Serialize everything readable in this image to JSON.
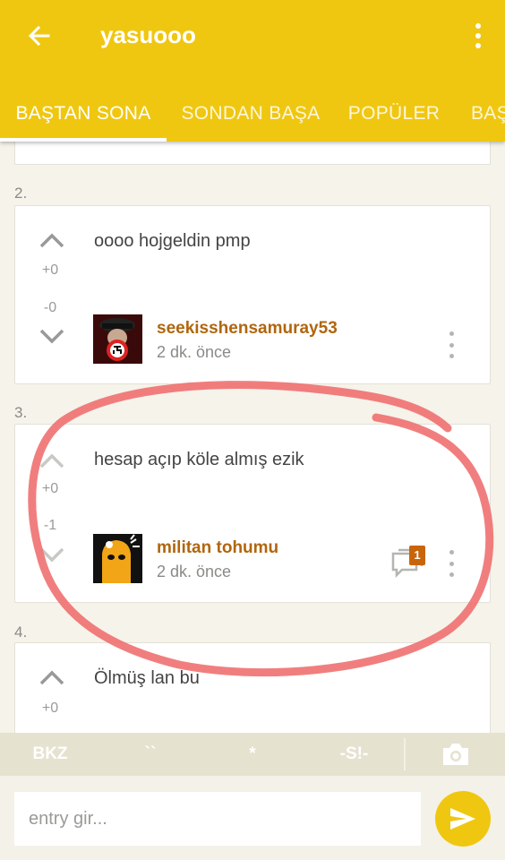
{
  "header": {
    "title": "yasuooo",
    "back_icon": "arrow-left-icon",
    "menu_icon": "more-vert-icon",
    "tabs": [
      {
        "label": "BAŞTAN SONA",
        "active": true
      },
      {
        "label": "SONDAN BAŞA",
        "active": false
      },
      {
        "label": "POPÜLER",
        "active": false
      },
      {
        "label": "BAŞ",
        "active": false
      }
    ]
  },
  "entries": [
    {
      "number": "2.",
      "text": "oooo hojgeldin pmp",
      "up_count": "+0",
      "down_count": "-0",
      "author": "seekisshensamuray53",
      "time": "2 dk. önce"
    },
    {
      "number": "3.",
      "text": "hesap açıp köle almış ezik",
      "up_count": "+0",
      "down_count": "-1",
      "author": "militan tohumu",
      "time": "2 dk. önce",
      "comment_count": "1"
    },
    {
      "number": "4.",
      "text": "Ölmüş lan bu",
      "up_count": "+0"
    }
  ],
  "toolbar": {
    "bkz": "BKZ",
    "quote": "``",
    "star": "*",
    "spoiler": "-S!-",
    "camera_icon": "camera-icon"
  },
  "composer": {
    "placeholder": "entry gir...",
    "send_icon": "send-icon"
  },
  "colors": {
    "accent": "#f0c710",
    "author": "#b0660e",
    "badge": "#c8650a",
    "highlight": "#f07070"
  }
}
